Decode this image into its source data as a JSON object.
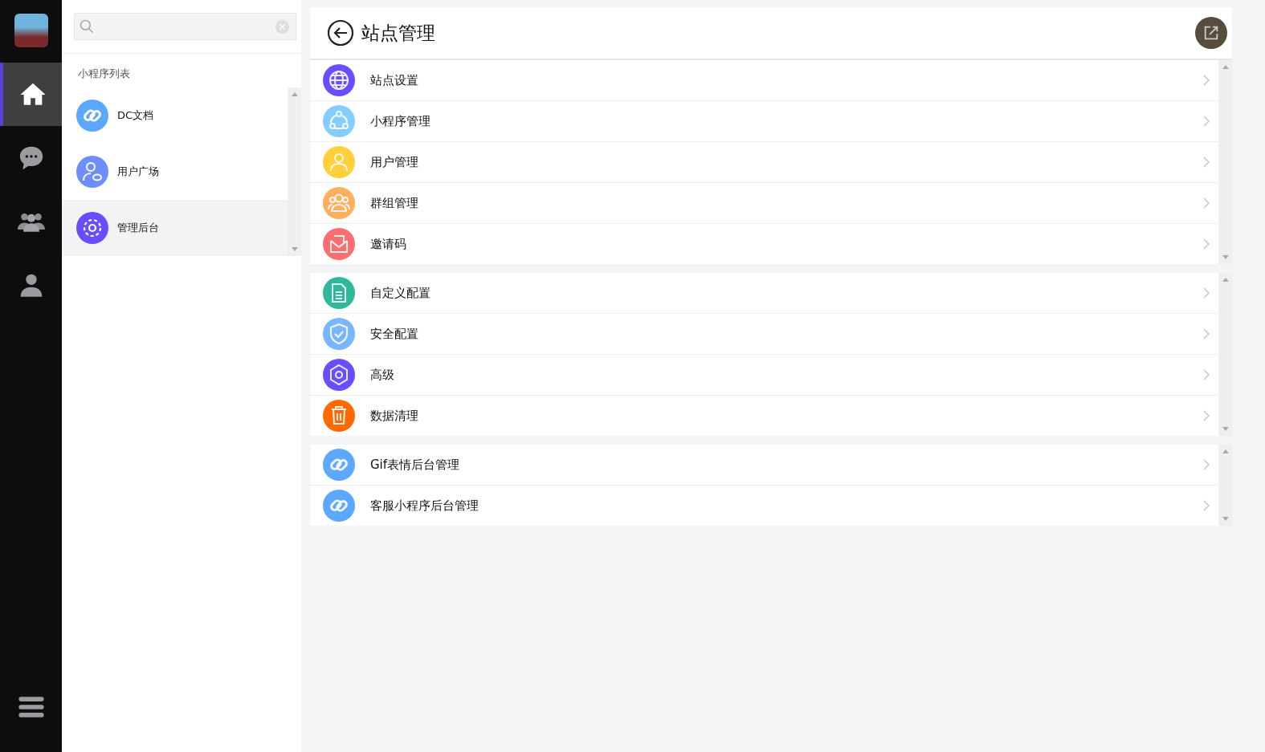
{
  "rail": {
    "items": [
      {
        "kind": "home",
        "selected": true
      },
      {
        "kind": "chat",
        "selected": false
      },
      {
        "kind": "group",
        "selected": false
      },
      {
        "kind": "user",
        "selected": false
      }
    ]
  },
  "sidebar": {
    "section_title": "小程序列表",
    "items": [
      {
        "label": "DC文档",
        "kind": "link",
        "color": "#5ca8ff",
        "selected": false
      },
      {
        "label": "用户广场",
        "kind": "user",
        "color": "#6e8dff",
        "selected": false
      },
      {
        "label": "管理后台",
        "kind": "gear",
        "color": "#6a4dff",
        "selected": true
      }
    ]
  },
  "page": {
    "title": "站点管理",
    "groups": [
      {
        "items": [
          {
            "label": "站点设置",
            "kind": "globe",
            "color": "#6a4dff"
          },
          {
            "label": "小程序管理",
            "kind": "nodes",
            "color": "#86cdff"
          },
          {
            "label": "用户管理",
            "kind": "user",
            "color": "#ffd03a"
          },
          {
            "label": "群组管理",
            "kind": "group",
            "color": "#ffae5c"
          },
          {
            "label": "邀请码",
            "kind": "mail",
            "color": "#ff6e6e"
          }
        ]
      },
      {
        "items": [
          {
            "label": "自定义配置",
            "kind": "doc",
            "color": "#2fb89c"
          },
          {
            "label": "安全配置",
            "kind": "shield",
            "color": "#7ab6ff"
          },
          {
            "label": "高级",
            "kind": "gear",
            "color": "#6a4dff"
          },
          {
            "label": "数据清理",
            "kind": "trash",
            "color": "#ff6a00"
          }
        ]
      },
      {
        "items": [
          {
            "label": "Gif表情后台管理",
            "kind": "link",
            "color": "#5ca8ff"
          },
          {
            "label": "客服小程序后台管理",
            "kind": "link",
            "color": "#5ca8ff"
          }
        ]
      }
    ]
  }
}
